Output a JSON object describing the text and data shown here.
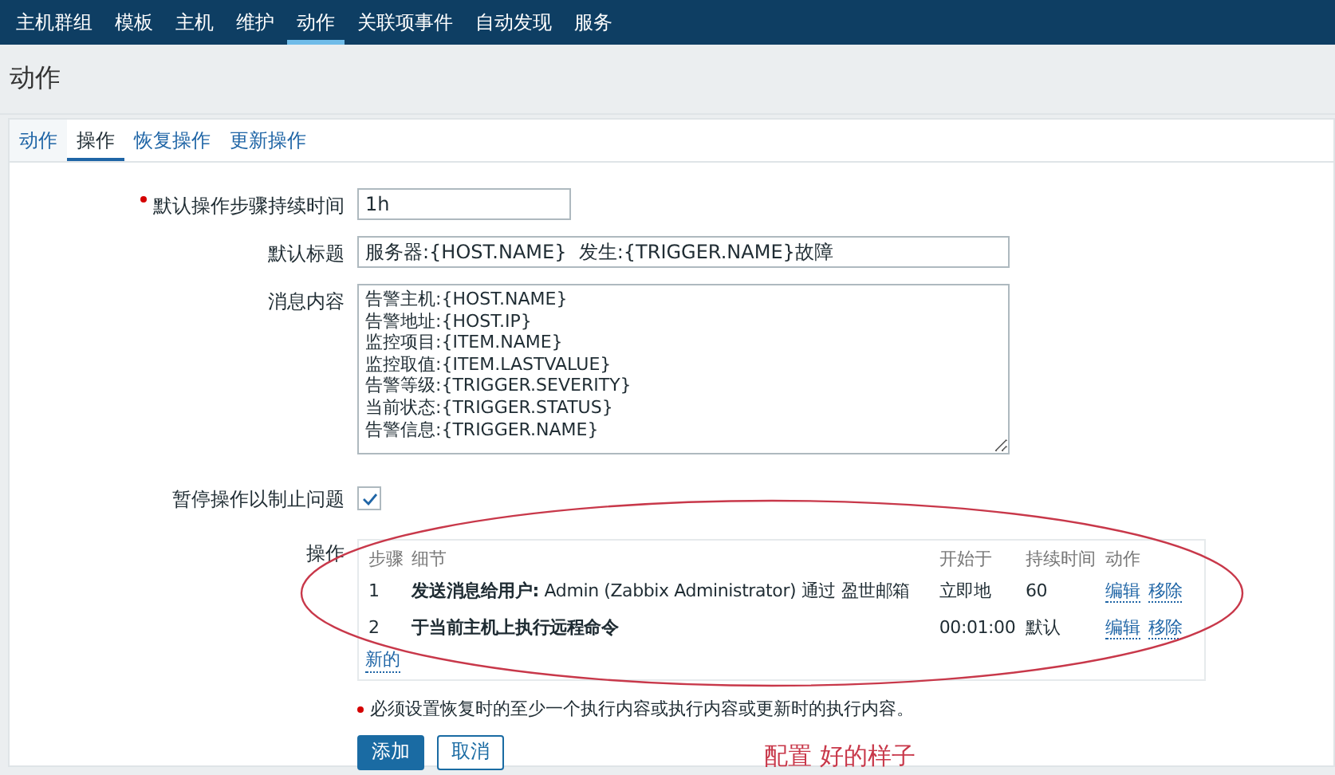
{
  "nav": [
    {
      "label": "主机群组",
      "selected": false
    },
    {
      "label": "模板",
      "selected": false
    },
    {
      "label": "主机",
      "selected": false
    },
    {
      "label": "维护",
      "selected": false
    },
    {
      "label": "动作",
      "selected": true
    },
    {
      "label": "关联项事件",
      "selected": false
    },
    {
      "label": "自动发现",
      "selected": false
    },
    {
      "label": "服务",
      "selected": false
    }
  ],
  "page_title": "动作",
  "tabs": [
    {
      "label": "动作",
      "selected": false
    },
    {
      "label": "操作",
      "selected": true
    },
    {
      "label": "恢复操作",
      "selected": false
    },
    {
      "label": "更新操作",
      "selected": false
    }
  ],
  "form": {
    "step_duration": {
      "label": "默认操作步骤持续时间",
      "required": true,
      "value": "1h"
    },
    "subject": {
      "label": "默认标题",
      "value": "服务器:{HOST.NAME}  发生:{TRIGGER.NAME}故障"
    },
    "message": {
      "label": "消息内容",
      "lines": [
        "告警主机:{HOST.NAME}",
        "告警地址:{HOST.IP}",
        "监控项目:{ITEM.NAME}",
        "监控取值:{ITEM.LASTVALUE}",
        "告警等级:{TRIGGER.SEVERITY}",
        "当前状态:{TRIGGER.STATUS}",
        "告警信息:{TRIGGER.NAME}"
      ]
    },
    "pause": {
      "label": "暂停操作以制止问题",
      "checked": true
    },
    "operations": {
      "label": "操作",
      "columns": [
        "步骤",
        "细节",
        "开始于",
        "持续时间",
        "动作"
      ],
      "rows": [
        {
          "step": "1",
          "detail_title": "发送消息给用户:",
          "detail_text": "Admin (Zabbix Administrator) 通过 盈世邮箱",
          "start": "立即地",
          "duration": "60",
          "actions": [
            "编辑",
            "移除"
          ]
        },
        {
          "step": "2",
          "detail_title": "于当前主机上执行远程命令",
          "start": "00:01:00",
          "duration": "默认",
          "actions": [
            "编辑",
            "移除"
          ]
        }
      ],
      "new_link": "新的"
    },
    "note": "必须设置恢复时的至少一个执行内容或执行内容或更新时的执行内容。",
    "buttons": [
      {
        "label": "添加",
        "kind": "primary"
      },
      {
        "label": "取消",
        "kind": "secondary"
      }
    ]
  },
  "annotation": "配置 好的样子"
}
